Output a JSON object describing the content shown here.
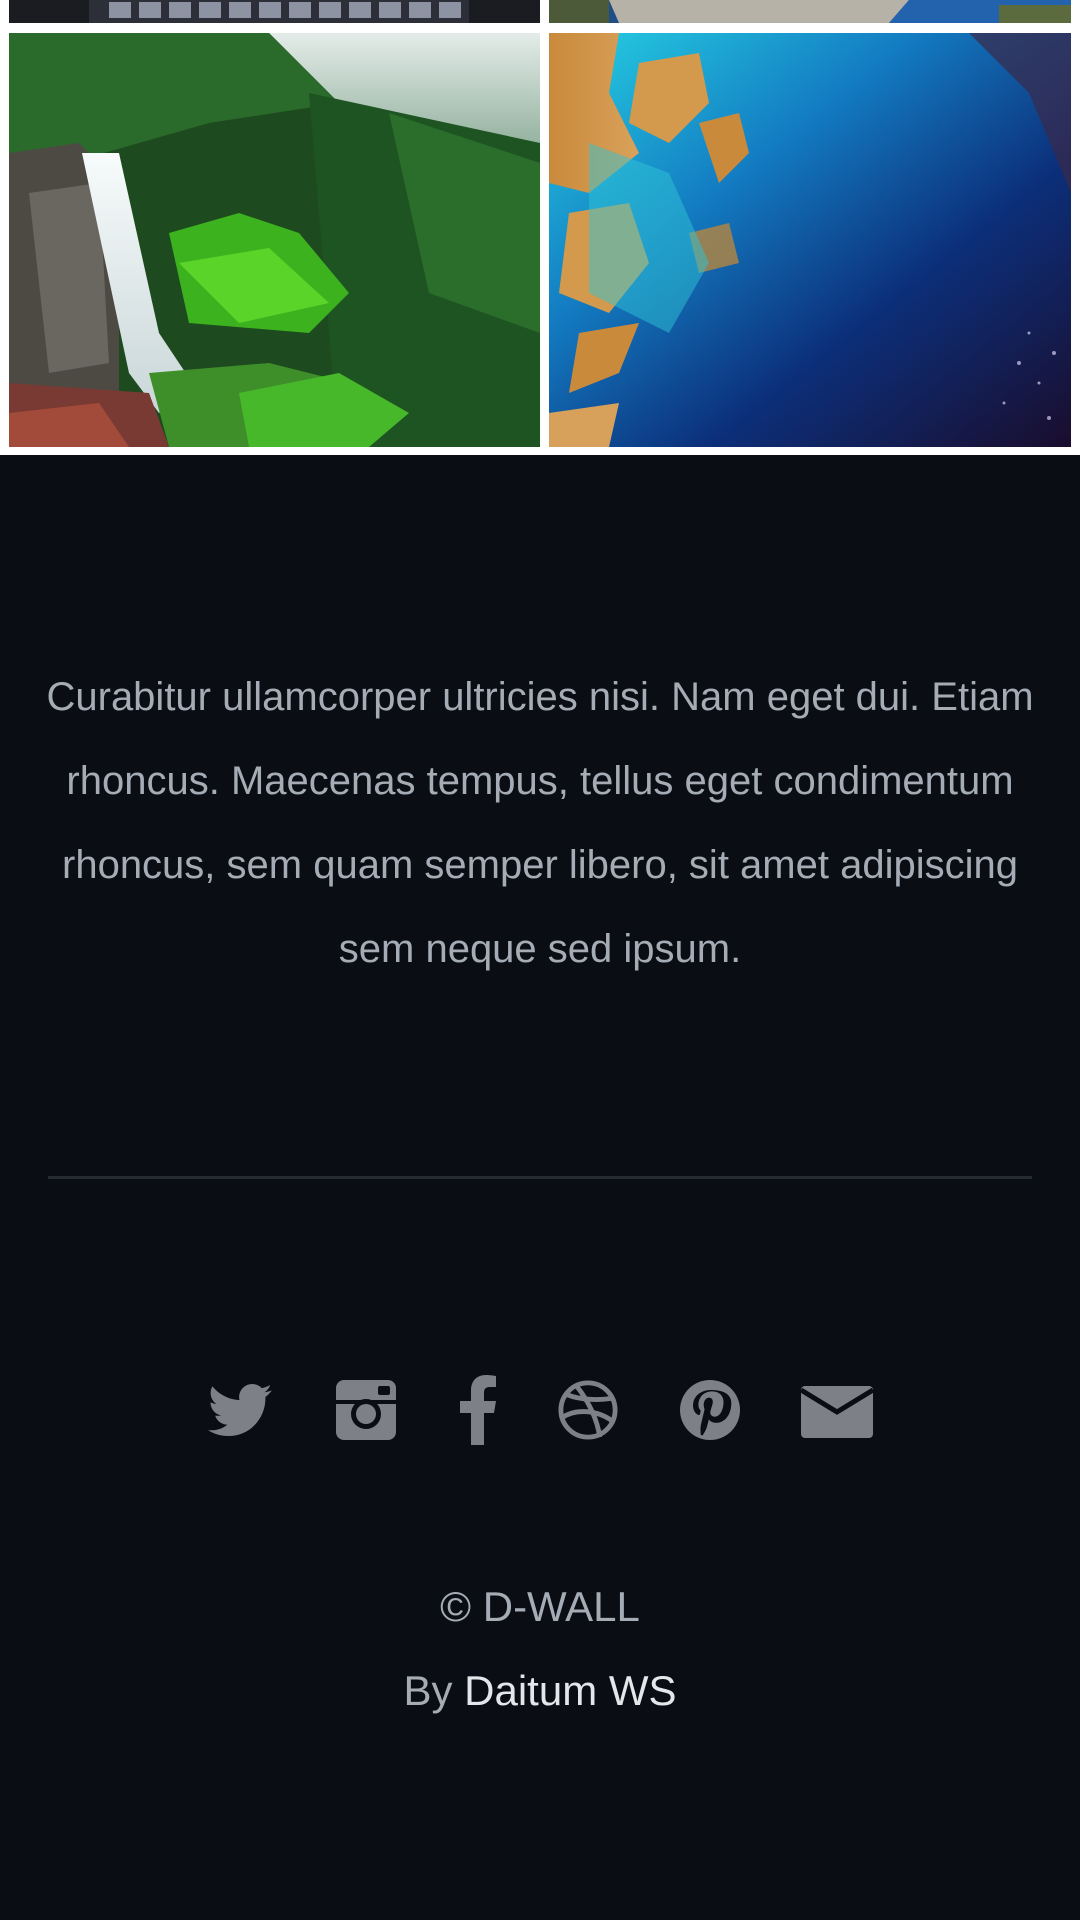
{
  "gallery": {
    "images": [
      {
        "subject": "building-facade-photo"
      },
      {
        "subject": "coastal-rocks-photo"
      },
      {
        "subject": "waterfall-forest-photo"
      },
      {
        "subject": "aerial-ocean-reef-photo"
      }
    ]
  },
  "footer": {
    "blurb": "Curabitur ullamcorper ultricies nisi. Nam eget dui. Etiam rhoncus. Maecenas tempus, tellus eget condimentum rhoncus, sem quam semper libero, sit amet adipiscing sem neque sed ipsum.",
    "social_icons": [
      "twitter-icon",
      "instagram-icon",
      "facebook-icon",
      "dribbble-icon",
      "pinterest-icon",
      "envelope-icon"
    ],
    "copyright": "© D-WALL",
    "by_prefix": "By ",
    "author_link": "Daitum WS"
  },
  "colors": {
    "footer_bg": "#0a0d14",
    "text": "#a5acb5",
    "link": "#e4e6e9",
    "icon": "#7d8187",
    "divider": "#262b33"
  }
}
